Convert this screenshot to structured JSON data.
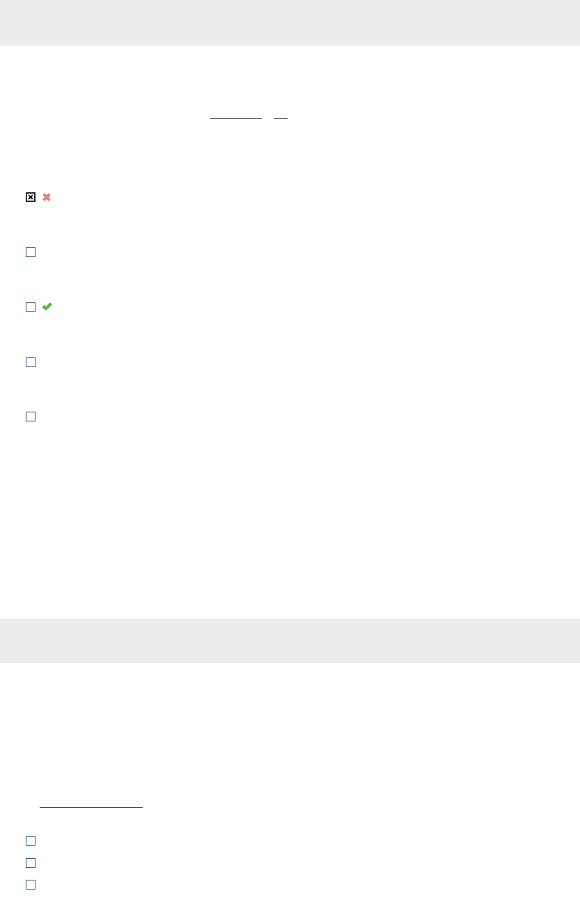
{
  "question_block_1": {
    "options": [
      {
        "checked": true,
        "result": "incorrect",
        "result_icon": "cross-icon",
        "result_color": "#e26b6b"
      },
      {
        "checked": false,
        "result": "none"
      },
      {
        "checked": false,
        "result": "correct",
        "result_icon": "checkmark-icon",
        "result_color": "#3fae1a"
      },
      {
        "checked": false,
        "result": "none"
      },
      {
        "checked": false,
        "result": "none"
      }
    ]
  },
  "question_block_2": {
    "options": [
      {
        "checked": false
      },
      {
        "checked": false
      },
      {
        "checked": false
      }
    ]
  },
  "colors": {
    "band": "#ededed",
    "checkbox_border": "#1f4f82",
    "incorrect": "#e26b6b",
    "correct": "#3fae1a"
  }
}
